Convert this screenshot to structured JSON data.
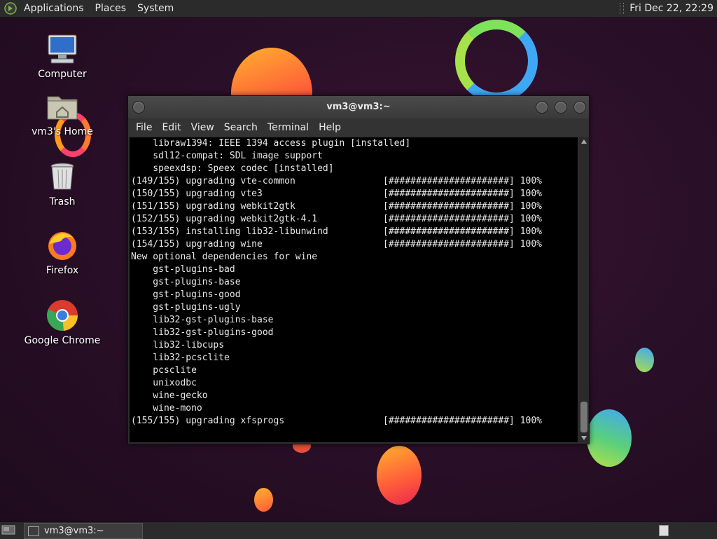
{
  "top_panel": {
    "menus": [
      "Applications",
      "Places",
      "System"
    ],
    "clock": "Fri Dec 22, 22:29"
  },
  "desktop_icons": [
    {
      "label": "Computer",
      "icon": "computer-icon"
    },
    {
      "label": "vm3's Home",
      "icon": "home-folder-icon"
    },
    {
      "label": "Trash",
      "icon": "trash-icon"
    },
    {
      "label": "Firefox",
      "icon": "firefox-icon"
    },
    {
      "label": "Google Chrome",
      "icon": "chrome-icon"
    }
  ],
  "terminal": {
    "title": "vm3@vm3:~",
    "menus": [
      "File",
      "Edit",
      "View",
      "Search",
      "Terminal",
      "Help"
    ],
    "lines": [
      "    libraw1394: IEEE 1394 access plugin [installed]",
      "    sdl12-compat: SDL image support",
      "    speexdsp: Speex codec [installed]",
      "(149/155) upgrading vte-common                [######################] 100%",
      "(150/155) upgrading vte3                      [######################] 100%",
      "(151/155) upgrading webkit2gtk                [######################] 100%",
      "(152/155) upgrading webkit2gtk-4.1            [######################] 100%",
      "(153/155) installing lib32-libunwind          [######################] 100%",
      "(154/155) upgrading wine                      [######################] 100%",
      "New optional dependencies for wine",
      "    gst-plugins-bad",
      "    gst-plugins-base",
      "    gst-plugins-good",
      "    gst-plugins-ugly",
      "    lib32-gst-plugins-base",
      "    lib32-gst-plugins-good",
      "    lib32-libcups",
      "    lib32-pcsclite",
      "    pcsclite",
      "    unixodbc",
      "    wine-gecko",
      "    wine-mono",
      "(155/155) upgrading xfsprogs                  [######################] 100%"
    ]
  },
  "taskbar": {
    "task_label": "vm3@vm3:~"
  }
}
